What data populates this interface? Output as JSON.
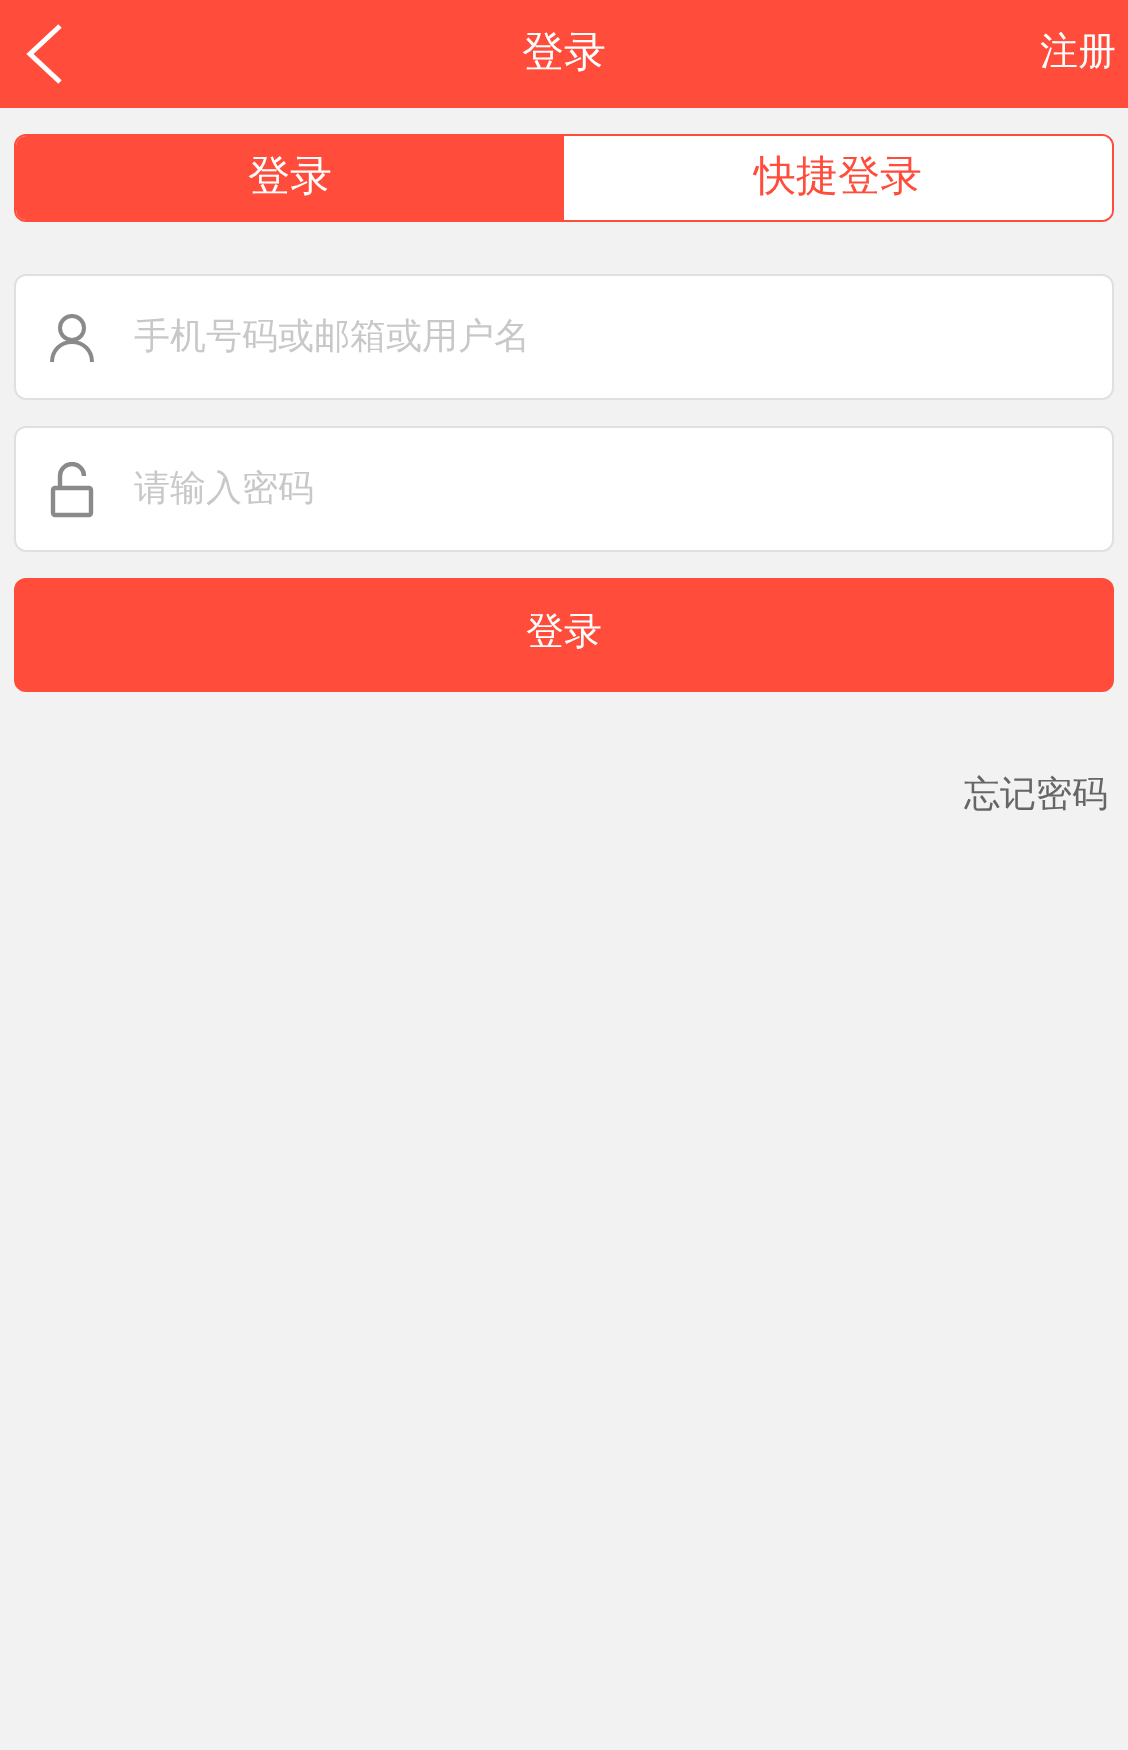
{
  "header": {
    "title": "登录",
    "action": "注册"
  },
  "tabs": [
    {
      "label": "登录",
      "selected": true
    },
    {
      "label": "快捷登录",
      "selected": false
    }
  ],
  "fields": [
    {
      "kind": "user",
      "placeholder": "手机号码或邮箱或用户名"
    },
    {
      "kind": "password",
      "placeholder": "请输入密码"
    }
  ],
  "submit": "登录",
  "forgot": "忘记密码"
}
